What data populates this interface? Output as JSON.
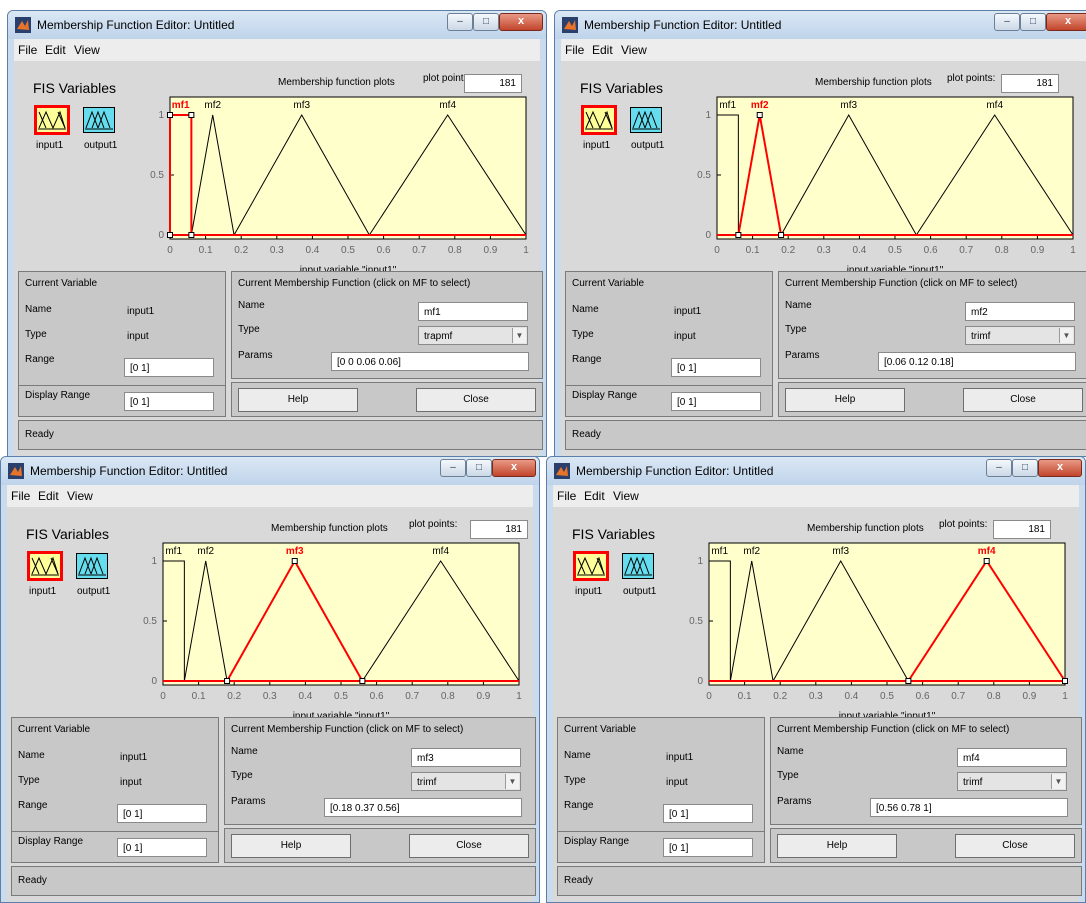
{
  "window_title": "Membership Function Editor: Untitled",
  "titlebar_buttons": {
    "minimize": "–",
    "maximize": "□",
    "close": "x"
  },
  "menu": [
    "File",
    "Edit",
    "View"
  ],
  "fis_variables_label": "FIS Variables",
  "variables": [
    "input1",
    "output1"
  ],
  "plot_header": {
    "mf_plots_label": "Membership function plots",
    "plot_points_label": "plot points:",
    "plot_points_value": "181"
  },
  "plot_axis": {
    "xlabel": "input variable \"input1\"",
    "xticks": [
      "0",
      "0.1",
      "0.2",
      "0.3",
      "0.4",
      "0.5",
      "0.6",
      "0.7",
      "0.8",
      "0.9",
      "1"
    ],
    "yticks": [
      "0",
      "0.5",
      "1"
    ]
  },
  "current_variable": {
    "heading": "Current Variable",
    "name_label": "Name",
    "name_value": "input1",
    "type_label": "Type",
    "type_value": "input",
    "range_label": "Range",
    "range_value": "[0 1]",
    "display_range_label": "Display Range",
    "display_range_value": "[0 1]"
  },
  "current_mf_labels": {
    "heading": "Current Membership Function (click on MF to select)",
    "name_label": "Name",
    "type_label": "Type",
    "params_label": "Params"
  },
  "buttons": {
    "help": "Help",
    "close": "Close"
  },
  "status": "Ready",
  "colors": {
    "plot_bg": "#ffffcc",
    "selected": "#ff0000",
    "curve": "#000000",
    "input_icon_fill": "#ffff99",
    "output_icon_fill": "#66ddee",
    "selected_border": "#ff0000"
  },
  "chart_data": {
    "type": "line",
    "xlabel": "input variable \"input1\"",
    "xlim": [
      0,
      1
    ],
    "ylim": [
      0,
      1
    ],
    "series": [
      {
        "name": "mf1",
        "type": "trapmf",
        "x": [
          0,
          0,
          0.06,
          0.06
        ],
        "y": [
          0,
          1,
          1,
          0
        ]
      },
      {
        "name": "mf2",
        "type": "trimf",
        "x": [
          0.06,
          0.12,
          0.18
        ],
        "y": [
          0,
          1,
          0
        ]
      },
      {
        "name": "mf3",
        "type": "trimf",
        "x": [
          0.18,
          0.37,
          0.56
        ],
        "y": [
          0,
          1,
          0
        ]
      },
      {
        "name": "mf4",
        "type": "trimf",
        "x": [
          0.56,
          0.78,
          1
        ],
        "y": [
          0,
          1,
          0
        ]
      }
    ]
  },
  "windows": [
    {
      "id": "w1",
      "selected_mf": "mf1",
      "mf_name": "mf1",
      "mf_type": "trapmf",
      "mf_params": "[0 0 0.06 0.06]"
    },
    {
      "id": "w2",
      "selected_mf": "mf2",
      "mf_name": "mf2",
      "mf_type": "trimf",
      "mf_params": "[0.06 0.12 0.18]"
    },
    {
      "id": "w3",
      "selected_mf": "mf3",
      "mf_name": "mf3",
      "mf_type": "trimf",
      "mf_params": "[0.18 0.37 0.56]"
    },
    {
      "id": "w4",
      "selected_mf": "mf4",
      "mf_name": "mf4",
      "mf_type": "trimf",
      "mf_params": "[0.56 0.78 1]"
    }
  ]
}
